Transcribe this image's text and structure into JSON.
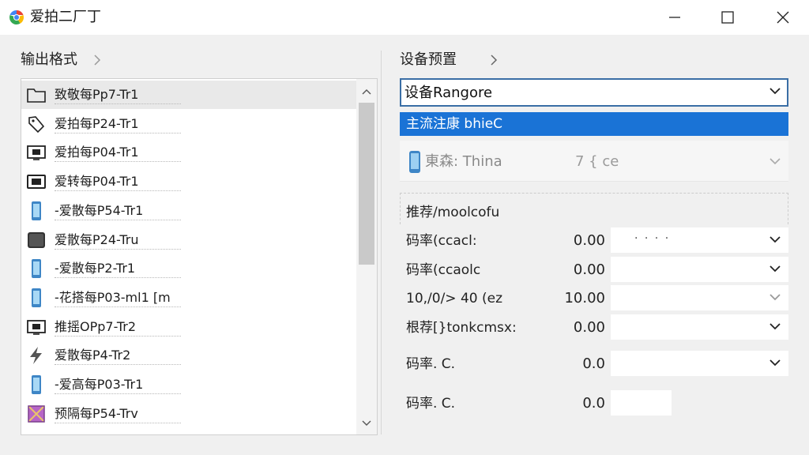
{
  "window": {
    "title": "爱拍二厂丁"
  },
  "left_panel": {
    "header": "输出格式",
    "items": [
      {
        "label": "致敬每Pp7-Tr1",
        "icon": "folder-icon"
      },
      {
        "label": "爱拍每P24-Tr1",
        "icon": "tag-icon"
      },
      {
        "label": "爱拍每P04-Tr1",
        "icon": "monitor-icon"
      },
      {
        "label": "爱转每P04-Tr1",
        "icon": "tv-icon"
      },
      {
        "label": "-爱散每P54-Tr1",
        "icon": "phone-icon"
      },
      {
        "label": "爱散每P24-Tru",
        "icon": "tablet-icon"
      },
      {
        "label": "-爱散每P2-Tr1",
        "icon": "phone-icon"
      },
      {
        "label": "-花搭每P03-ml1 [m",
        "icon": "phone-icon"
      },
      {
        "label": "推摇OPp7-Tr2",
        "icon": "monitor-icon"
      },
      {
        "label": "爱散每P4-Tr2",
        "icon": "bolt-icon"
      },
      {
        "label": "-爱高每P03-Tr1",
        "icon": "phone-icon"
      },
      {
        "label": "预隔每P54-Trv",
        "icon": "image-icon"
      }
    ]
  },
  "right_panel": {
    "header": "设备预置",
    "device_combo": {
      "value": "设备Rangore"
    },
    "dropdown_selected": "主流注康 bhieC",
    "dropdown_row": {
      "label": "東森: Thina",
      "extra": "7 { ce"
    },
    "section_title": "推荐/moolcofu",
    "params": [
      {
        "label": "码率(ccacl:",
        "value": "0.00",
        "has_dots": true,
        "dots": "· · · ·"
      },
      {
        "label": "码率(ccaolc",
        "value": "0.00"
      },
      {
        "label": "10,/0/>   40 (ez",
        "value": "10.00"
      },
      {
        "label": "根荐[}tonkcmsx:",
        "value": "0.00"
      },
      {
        "label": "码率. C.",
        "value": "0.0"
      },
      {
        "label": "码率. C.",
        "value": "0.0"
      }
    ]
  },
  "colors": {
    "selection": "#1a73d6",
    "combo_border": "#3a6ea5",
    "background": "#f0f0f0"
  }
}
